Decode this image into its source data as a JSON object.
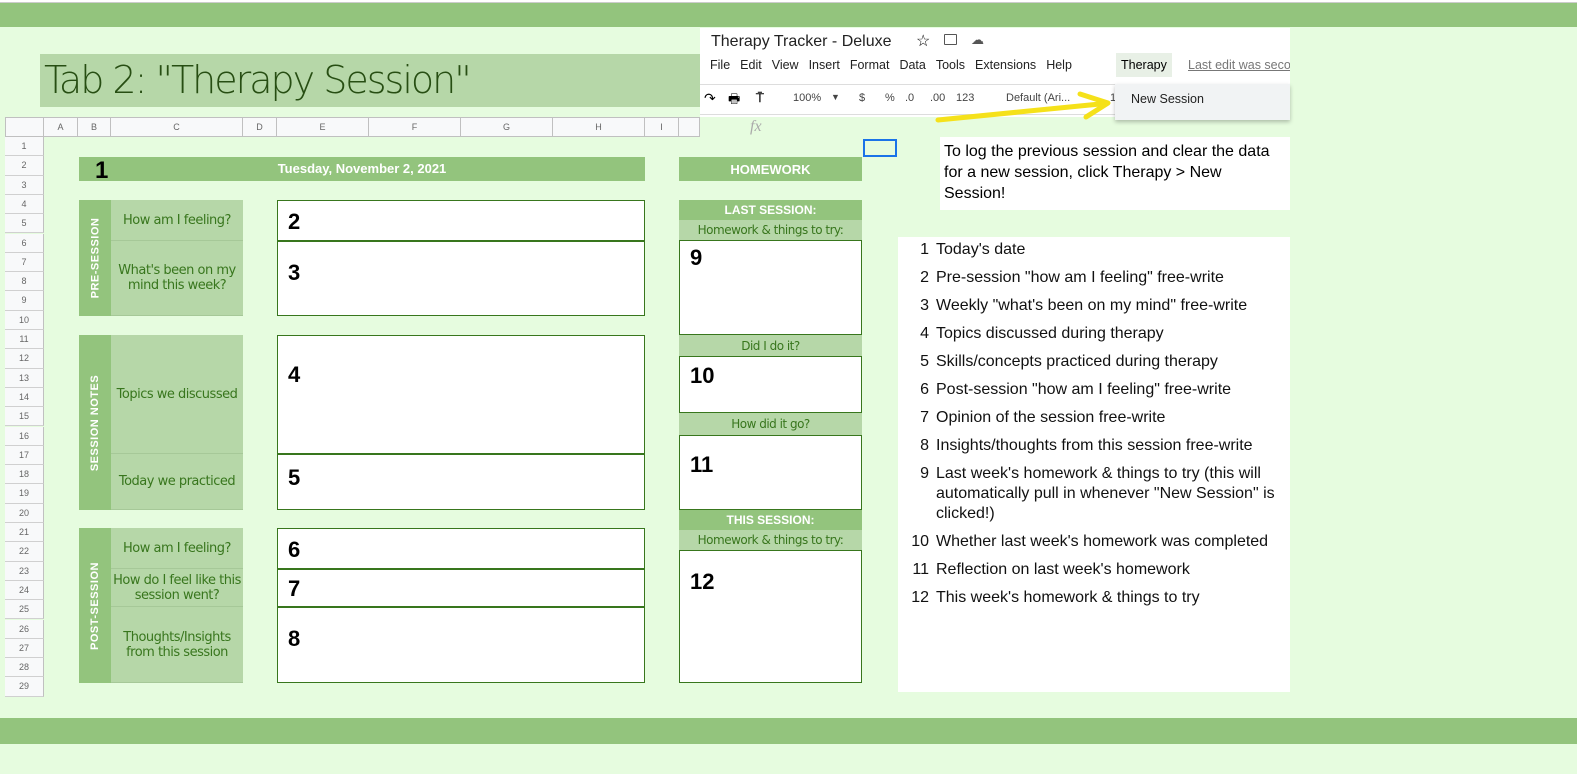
{
  "title": "Tab 2: \"Therapy Session\"",
  "columns": [
    "A",
    "B",
    "C",
    "D",
    "E",
    "F",
    "G",
    "H",
    "I"
  ],
  "rows": [
    "1",
    "2",
    "3",
    "4",
    "5",
    "6",
    "7",
    "8",
    "9",
    "10",
    "11",
    "12",
    "13",
    "14",
    "15",
    "16",
    "17",
    "18",
    "19",
    "20",
    "21",
    "22",
    "23",
    "24",
    "25",
    "26",
    "27",
    "28",
    "29"
  ],
  "sheet": {
    "date_marker": "1",
    "date": "Tuesday, November 2, 2021",
    "homework": "HOMEWORK",
    "pre": {
      "label": "PRE-SESSION",
      "q1": "How am I feeling?",
      "q2": "What's been on my mind this week?",
      "n1": "2",
      "n2": "3"
    },
    "notes": {
      "label": "SESSION NOTES",
      "q1": "Topics we discussed",
      "q2": "Today we practiced",
      "n1": "4",
      "n2": "5"
    },
    "post": {
      "label": "POST-SESSION",
      "q1": "How am I feeling?",
      "q2": "How do I feel like this session went?",
      "q3": "Thoughts/Insights from this session",
      "n1": "6",
      "n2": "7",
      "n3": "8"
    },
    "hw": {
      "last": "LAST SESSION:",
      "last_sub": "Homework & things to try:",
      "n9": "9",
      "did": "Did I do it?",
      "n10": "10",
      "how": "How did it go?",
      "n11": "11",
      "this": "THIS SESSION:",
      "this_sub": "Homework & things to try:",
      "n12": "12"
    }
  },
  "window": {
    "doc_title": "Therapy Tracker - Deluxe",
    "menu": [
      "File",
      "Edit",
      "View",
      "Insert",
      "Format",
      "Data",
      "Tools",
      "Extensions",
      "Help"
    ],
    "active_menu": "Therapy",
    "last_edit": "Last edit was seco",
    "zoom": "100%",
    "currency": "$",
    "percent": "%",
    "dec_less": ".0",
    "dec_more": ".00",
    "format": "123",
    "font": "Default (Ari...",
    "font_size": "1",
    "menu_item": "New Session",
    "fx": "fx"
  },
  "instructions": "To log the previous session and clear the data for a new session, click Therapy > New Session!",
  "legend": [
    {
      "n": "1",
      "t": "Today's date"
    },
    {
      "n": "2",
      "t": "Pre-session \"how am I feeling\" free-write"
    },
    {
      "n": "3",
      "t": "Weekly \"what's been on my mind\" free-write"
    },
    {
      "n": "4",
      "t": "Topics discussed during therapy"
    },
    {
      "n": "5",
      "t": "Skills/concepts practiced during therapy"
    },
    {
      "n": "6",
      "t": "Post-session \"how am I feeling\" free-write"
    },
    {
      "n": "7",
      "t": "Opinion of the session free-write"
    },
    {
      "n": "8",
      "t": "Insights/thoughts from this session free-write"
    },
    {
      "n": "9",
      "t": "Last week's homework & things to try (this will automatically pull in whenever \"New Session\" is clicked!)"
    },
    {
      "n": "10",
      "t": "Whether last week's homework was completed"
    },
    {
      "n": "11",
      "t": "Reflection on last week's homework"
    },
    {
      "n": "12",
      "t": "This week's homework & things to try"
    }
  ]
}
